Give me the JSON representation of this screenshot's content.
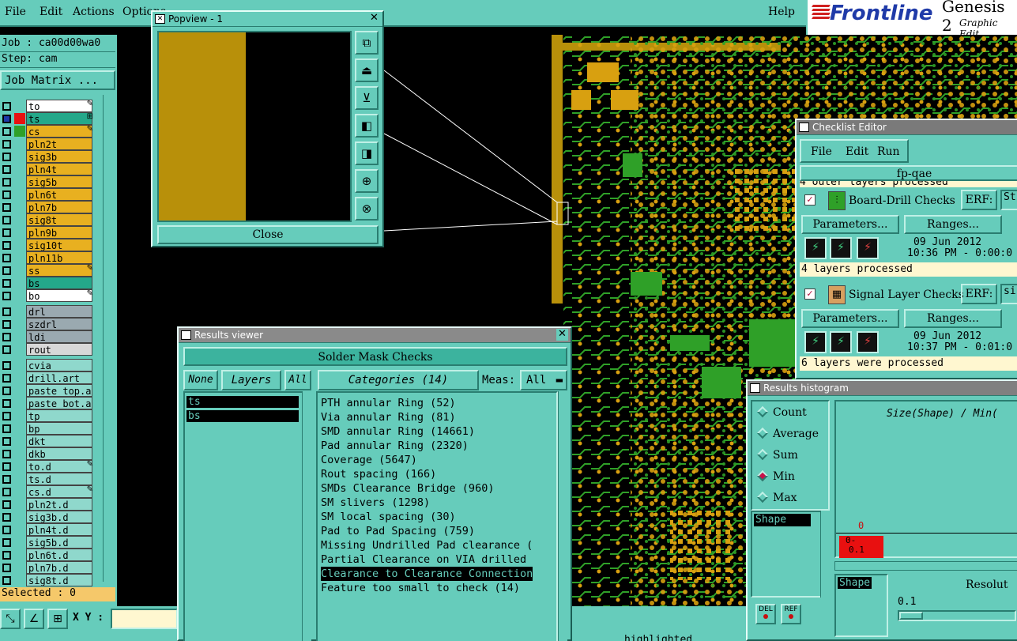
{
  "menubar": {
    "items": [
      "File",
      "Edit",
      "Actions",
      "Options"
    ],
    "help": "Help"
  },
  "brand": {
    "logo": "Frontline",
    "product": "Genesis 2",
    "subtitle": "Graphic Edit"
  },
  "job": {
    "job_line": "Job : ca00d00wa0",
    "step_line": "Step: cam",
    "job_matrix": "Job Matrix ..."
  },
  "layers": [
    {
      "name": "to",
      "color": "#ffffff",
      "mark": "✎"
    },
    {
      "name": "ts",
      "color": "#24a88a",
      "mark": "⊞",
      "active": true
    },
    {
      "name": "cs",
      "color": "#e8b020",
      "mark": "✎",
      "on": true
    },
    {
      "name": "pln2t",
      "color": "#e8b020"
    },
    {
      "name": "sig3b",
      "color": "#e8b020"
    },
    {
      "name": "pln4t",
      "color": "#e8b020"
    },
    {
      "name": "sig5b",
      "color": "#e8b020"
    },
    {
      "name": "pln6t",
      "color": "#e8b020"
    },
    {
      "name": "pln7b",
      "color": "#e8b020"
    },
    {
      "name": "sig8t",
      "color": "#e8b020"
    },
    {
      "name": "pln9b",
      "color": "#e8b020"
    },
    {
      "name": "sig10t",
      "color": "#e8b020"
    },
    {
      "name": "pln11b",
      "color": "#e8b020"
    },
    {
      "name": "ss",
      "color": "#e8b020",
      "mark": "✎"
    },
    {
      "name": "bs",
      "color": "#24a88a"
    },
    {
      "name": "bo",
      "color": "#ffffff",
      "mark": "✎"
    }
  ],
  "layers2": [
    {
      "name": "drl",
      "color": "#9aa9b0"
    },
    {
      "name": "szdrl",
      "color": "#9aa9b0"
    },
    {
      "name": "ldi",
      "color": "#9aa9b0"
    },
    {
      "name": "rout",
      "color": "#d8d8d8"
    }
  ],
  "layers3": [
    {
      "name": "cvia",
      "color": "#8fd8cc"
    },
    {
      "name": "drill.art",
      "color": "#8fd8cc"
    },
    {
      "name": "paste_top.ar",
      "color": "#8fd8cc"
    },
    {
      "name": "paste_bot.ar",
      "color": "#8fd8cc"
    },
    {
      "name": "tp",
      "color": "#8fd8cc"
    },
    {
      "name": "bp",
      "color": "#8fd8cc"
    },
    {
      "name": "dkt",
      "color": "#8fd8cc"
    },
    {
      "name": "dkb",
      "color": "#8fd8cc"
    },
    {
      "name": "to.d",
      "color": "#8fd8cc",
      "mark": "✎"
    },
    {
      "name": "ts.d",
      "color": "#8fd8cc"
    },
    {
      "name": "cs.d",
      "color": "#8fd8cc",
      "mark": "✎"
    },
    {
      "name": "pln2t.d",
      "color": "#8fd8cc"
    },
    {
      "name": "sig3b.d",
      "color": "#8fd8cc"
    },
    {
      "name": "pln4t.d",
      "color": "#8fd8cc"
    },
    {
      "name": "sig5b.d",
      "color": "#8fd8cc"
    },
    {
      "name": "pln6t.d",
      "color": "#8fd8cc"
    },
    {
      "name": "pln7b.d",
      "color": "#8fd8cc"
    },
    {
      "name": "sig8t.d",
      "color": "#8fd8cc"
    }
  ],
  "selected": "Selected : 0",
  "bottombar": {
    "xy_label": "X Y :",
    "xy_value": "",
    "status_tail": "highlighted"
  },
  "popview": {
    "title": "Popview - 1",
    "close_label": "Close"
  },
  "results": {
    "title": "Results viewer",
    "check_name": "Solder Mask Checks",
    "btn_none": "None",
    "btn_layers": "Layers",
    "btn_all": "All",
    "categories_label": "Categories (14)",
    "meas_label": "Meas:",
    "meas_value": "All",
    "layer_items": [
      "ts",
      "bs"
    ],
    "categories": [
      "PTH annular Ring (52)",
      "Via annular Ring (81)",
      "SMD annular Ring (14661)",
      "Pad annular Ring (2320)",
      "Coverage (5647)",
      "Rout spacing (166)",
      "SMDs Clearance Bridge (960)",
      "SM slivers (1298)",
      "SM local spacing (30)",
      "Pad to Pad Spacing (759)",
      "Missing Undrilled Pad clearance (",
      "Partial Clearance on VIA drilled",
      "Clearance to Clearance Connection",
      "Feature too small to check (14)"
    ],
    "selected_index": 12
  },
  "checklist": {
    "title": "Checklist Editor",
    "menu": [
      "File",
      "Edit",
      "Run"
    ],
    "name": "fp-qae",
    "actions": [
      {
        "name": "Board-Drill Checks",
        "erf": "ERF:",
        "erf_val": "St",
        "params": "Parameters...",
        "ranges": "Ranges...",
        "date1": "09 Jun 2012",
        "date2": "10:36 PM - 0:00:0",
        "status": "4 layers processed"
      },
      {
        "name": "Signal Layer Checks",
        "erf": "ERF:",
        "erf_val": "si",
        "params": "Parameters...",
        "ranges": "Ranges...",
        "date1": "09 Jun 2012",
        "date2": "10:37 PM - 0:01:0",
        "status": "6 layers were processed"
      }
    ],
    "top_partial": "4 outer layers processed"
  },
  "histogram": {
    "title": "Results histogram",
    "options": [
      "Count",
      "Average",
      "Sum",
      "Min",
      "Max"
    ],
    "selected_option": "Min",
    "shape_item": "Shape",
    "axis_title": "Size(Shape) / Min(",
    "bar_top_label": "0",
    "bar_range": "0-",
    "bar_range2": "0.1",
    "btn_del": "DEL",
    "btn_ref": "REF",
    "shape_label": "Shape",
    "resolution_label": "Resolut",
    "resolution_value": "0.1"
  },
  "colors": {
    "panel": "#66ccbb",
    "gold": "#b8900a",
    "green": "#2fa028",
    "copper": "#d8a010"
  }
}
